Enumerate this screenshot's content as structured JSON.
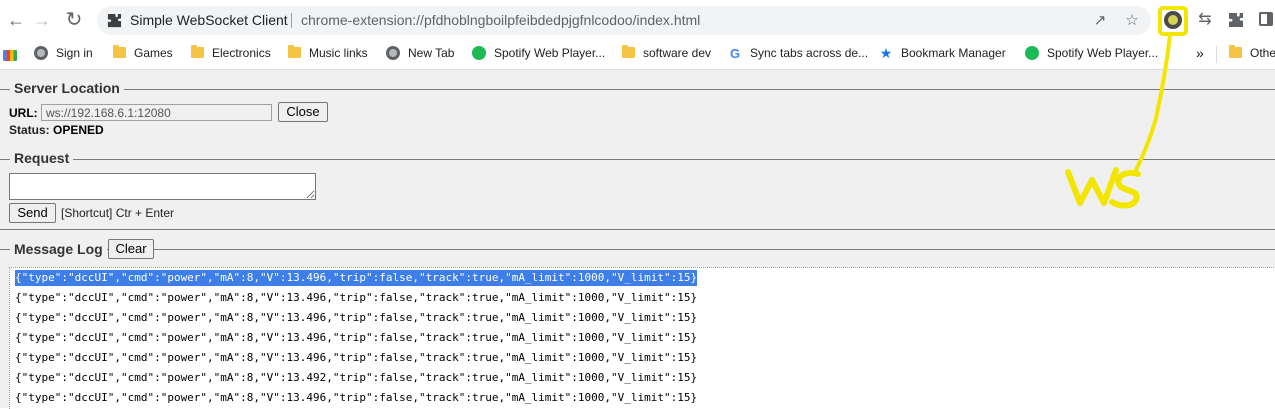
{
  "browser": {
    "tab_title": "Simple WebSocket Client",
    "url": "chrome-extension://pfdhoblngboilpfeibdedpjgfnlcodoo/index.html"
  },
  "bookmarks": [
    {
      "label": "Sign in",
      "icon": "globe-icon"
    },
    {
      "label": "Games",
      "icon": "folder-icon"
    },
    {
      "label": "Electronics",
      "icon": "folder-icon"
    },
    {
      "label": "Music links",
      "icon": "folder-icon"
    },
    {
      "label": "New Tab",
      "icon": "globe-icon"
    },
    {
      "label": "Spotify Web Player...",
      "icon": "spotify-icon"
    },
    {
      "label": "software dev",
      "icon": "folder-icon"
    },
    {
      "label": "Sync tabs across de...",
      "icon": "google-icon"
    },
    {
      "label": "Bookmark Manager",
      "icon": "star-icon"
    },
    {
      "label": "Spotify Web Player...",
      "icon": "spotify-icon"
    },
    {
      "label": "Othe",
      "icon": "folder-icon"
    }
  ],
  "bookmarks_overflow": "»",
  "server": {
    "legend": "Server Location",
    "url_label": "URL:",
    "url_value": "ws://192.168.6.1:12080",
    "close_label": "Close",
    "status_label": "Status:",
    "status_value": "OPENED"
  },
  "request": {
    "legend": "Request",
    "send_label": "Send",
    "shortcut_hint": "[Shortcut] Ctr + Enter"
  },
  "log": {
    "legend": "Message Log",
    "clear_label": "Clear",
    "messages": [
      "{\"type\":\"dccUI\",\"cmd\":\"power\",\"mA\":8,\"V\":13.496,\"trip\":false,\"track\":true,\"mA_limit\":1000,\"V_limit\":15}",
      "{\"type\":\"dccUI\",\"cmd\":\"power\",\"mA\":8,\"V\":13.496,\"trip\":false,\"track\":true,\"mA_limit\":1000,\"V_limit\":15}",
      "{\"type\":\"dccUI\",\"cmd\":\"power\",\"mA\":8,\"V\":13.496,\"trip\":false,\"track\":true,\"mA_limit\":1000,\"V_limit\":15}",
      "{\"type\":\"dccUI\",\"cmd\":\"power\",\"mA\":8,\"V\":13.496,\"trip\":false,\"track\":true,\"mA_limit\":1000,\"V_limit\":15}",
      "{\"type\":\"dccUI\",\"cmd\":\"power\",\"mA\":8,\"V\":13.496,\"trip\":false,\"track\":true,\"mA_limit\":1000,\"V_limit\":15}",
      "{\"type\":\"dccUI\",\"cmd\":\"power\",\"mA\":8,\"V\":13.492,\"trip\":false,\"track\":true,\"mA_limit\":1000,\"V_limit\":15}",
      "{\"type\":\"dccUI\",\"cmd\":\"power\",\"mA\":8,\"V\":13.496,\"trip\":false,\"track\":true,\"mA_limit\":1000,\"V_limit\":15}"
    ],
    "selected_index": 0
  },
  "annotation": {
    "text": "ws",
    "color": "#f2e600"
  },
  "colors": {
    "selection": "#3d7ee8",
    "page_background": "#f0f0f0"
  }
}
